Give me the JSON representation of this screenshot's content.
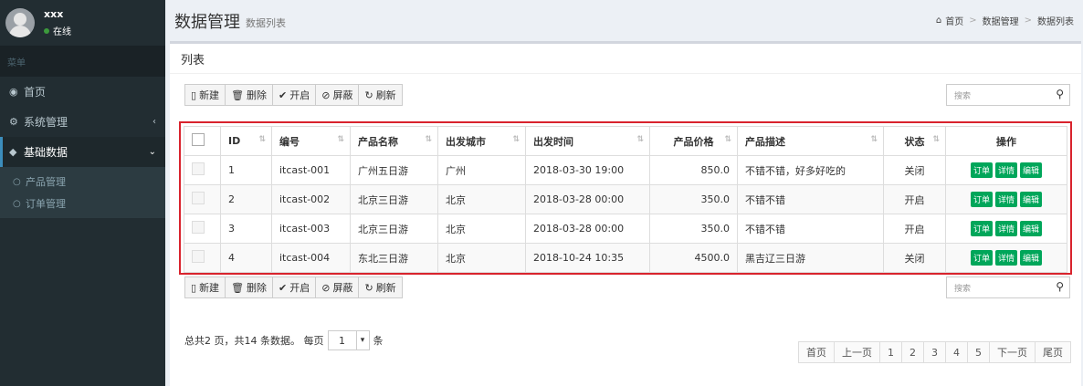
{
  "user": {
    "name": "xxx",
    "status": "在线"
  },
  "sidebar": {
    "header": "菜单",
    "items": [
      {
        "label": "首页",
        "icon": "dashboard-icon"
      },
      {
        "label": "系统管理",
        "icon": "cogs-icon",
        "arrow": "‹"
      },
      {
        "label": "基础数据",
        "icon": "cube-icon",
        "arrow": "⌄"
      }
    ],
    "submenu": [
      {
        "label": "产品管理"
      },
      {
        "label": "订单管理"
      }
    ]
  },
  "header": {
    "title": "数据管理",
    "subtitle": "数据列表"
  },
  "breadcrumb": [
    "首页",
    "数据管理",
    "数据列表"
  ],
  "box": {
    "title": "列表"
  },
  "toolbar": {
    "new": "新建",
    "delete": "删除",
    "open": "开启",
    "block": "屏蔽",
    "refresh": "刷新"
  },
  "search": {
    "placeholder": "搜索"
  },
  "table": {
    "headers": [
      "ID",
      "编号",
      "产品名称",
      "出发城市",
      "出发时间",
      "产品价格",
      "产品描述",
      "状态",
      "操作"
    ],
    "rows": [
      {
        "id": "1",
        "code": "itcast-001",
        "name": "广州五日游",
        "city": "广州",
        "time": "2018-03-30 19:00",
        "price": "850.0",
        "desc": "不错不错，好多好吃的",
        "status": "关闭"
      },
      {
        "id": "2",
        "code": "itcast-002",
        "name": "北京三日游",
        "city": "北京",
        "time": "2018-03-28 00:00",
        "price": "350.0",
        "desc": "不错不错",
        "status": "开启"
      },
      {
        "id": "3",
        "code": "itcast-003",
        "name": "北京三日游",
        "city": "北京",
        "time": "2018-03-28 00:00",
        "price": "350.0",
        "desc": "不错不错",
        "status": "开启"
      },
      {
        "id": "4",
        "code": "itcast-004",
        "name": "东北三日游",
        "city": "北京",
        "time": "2018-10-24 10:35",
        "price": "4500.0",
        "desc": "黑吉辽三日游",
        "status": "关闭"
      }
    ],
    "actions": [
      "订单",
      "详情",
      "编辑"
    ]
  },
  "footer": {
    "prefix": "总共2 页，共14 条数据。 每页",
    "per_page": "1",
    "suffix": "条"
  },
  "pagination": [
    "首页",
    "上一页",
    "1",
    "2",
    "3",
    "4",
    "5",
    "下一页",
    "尾页"
  ]
}
